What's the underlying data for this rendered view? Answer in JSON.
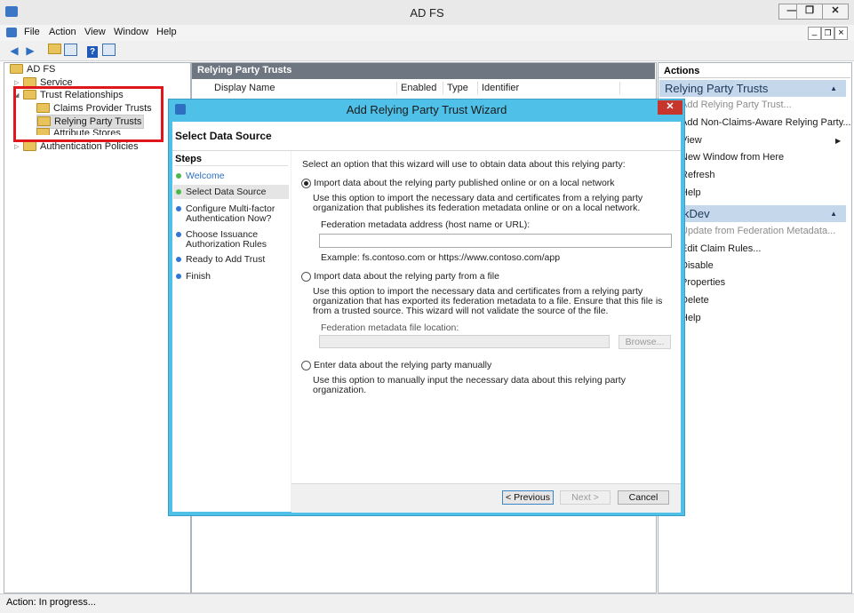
{
  "app": {
    "title": "AD FS",
    "window_buttons": [
      "—",
      "❐",
      "✕"
    ],
    "inner_window_buttons": [
      "_",
      "❐",
      "×"
    ]
  },
  "menu": {
    "items": [
      "File",
      "Action",
      "View",
      "Window",
      "Help"
    ]
  },
  "toolbar": {
    "icons": [
      "back-icon",
      "forward-icon",
      "up-folder-icon",
      "show-hide-tree-icon",
      "help-icon",
      "show-hide-action-pane-icon"
    ]
  },
  "tree": {
    "root": "AD FS",
    "service": "Service",
    "trust_relationships": "Trust Relationships",
    "claims_provider_trusts": "Claims Provider Trusts",
    "relying_party_trusts": "Relying Party Trusts",
    "attribute_stores": "Attribute Stores",
    "authentication_policies": "Authentication Policies"
  },
  "center": {
    "header": "Relying Party Trusts",
    "columns": [
      "Display Name",
      "Enabled",
      "Type",
      "Identifier"
    ]
  },
  "actions": {
    "title": "Actions",
    "section1": {
      "label": "Relying Party Trusts",
      "items": [
        "Add Relying Party Trust...",
        "Add Non-Claims-Aware Relying Party...",
        "View",
        "New Window from Here",
        "Refresh",
        "Help"
      ]
    },
    "section2": {
      "label": "deskDev",
      "items": [
        "Update from Federation Metadata...",
        "Edit Claim Rules...",
        "Disable",
        "Properties",
        "Delete",
        "Help"
      ]
    }
  },
  "status": {
    "text": "Action:  In progress..."
  },
  "wizard": {
    "title": "Add Relying Party Trust Wizard",
    "close": "✕",
    "heading": "Select Data Source",
    "steps_title": "Steps",
    "steps": [
      {
        "label": "Welcome",
        "state": "done"
      },
      {
        "label": "Select Data Source",
        "state": "current"
      },
      {
        "label": "Configure Multi-factor Authentication Now?",
        "state": "pending"
      },
      {
        "label": "Choose Issuance Authorization Rules",
        "state": "pending"
      },
      {
        "label": "Ready to Add Trust",
        "state": "pending"
      },
      {
        "label": "Finish",
        "state": "pending"
      }
    ],
    "intro": "Select an option that this wizard will use to obtain data about this relying party:",
    "option_online": {
      "label": "Import data about the relying party published online or on a local network",
      "desc": "Use this option to import the necessary data and certificates from a relying party organization that publishes its federation metadata online or on a local network.",
      "field_label": "Federation metadata address (host name or URL):",
      "field_value": "",
      "example": "Example: fs.contoso.com or https://www.contoso.com/app",
      "selected": true
    },
    "option_file": {
      "label": "Import data about the relying party from a file",
      "desc": "Use this option to import the necessary data and certificates from a relying party organization that has exported its federation metadata to a file. Ensure that this file is from a trusted source.  This wizard will not validate the source of the file.",
      "field_label": "Federation metadata file location:",
      "field_value": "",
      "browse": "Browse..."
    },
    "option_manual": {
      "label": "Enter data about the relying party manually",
      "desc": "Use this option to manually input the necessary data about this relying party organization."
    },
    "buttons": {
      "previous": "< Previous",
      "next": "Next >",
      "cancel": "Cancel"
    }
  },
  "colors": {
    "highlight": "#e0161c",
    "accent": "#4fc1e9",
    "section": "#c5d7ea"
  }
}
